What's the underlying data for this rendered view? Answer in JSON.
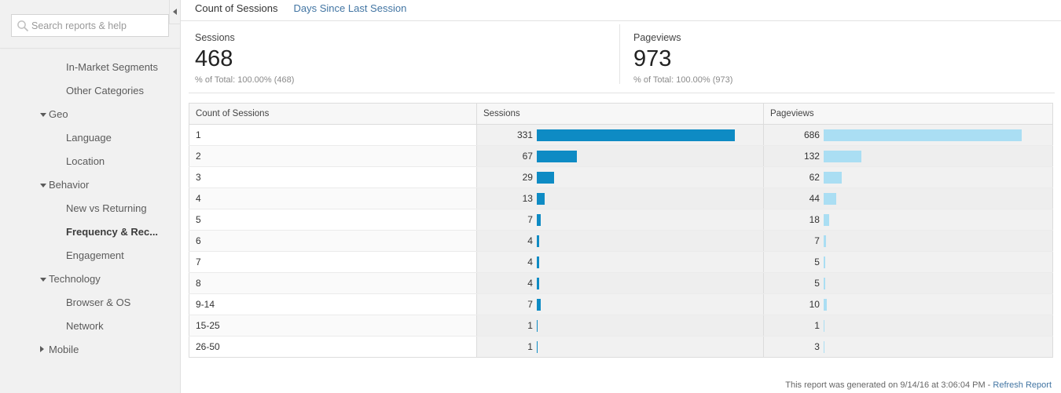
{
  "sidebar": {
    "search": {
      "placeholder": "Search reports & help",
      "value": "",
      "icon": "search-icon"
    },
    "items": [
      {
        "label": "In-Market Segments",
        "type": "leaf",
        "active": false,
        "caret": ""
      },
      {
        "label": "Other Categories",
        "type": "leaf",
        "active": false,
        "caret": ""
      },
      {
        "label": "Geo",
        "type": "group",
        "active": false,
        "caret": "open"
      },
      {
        "label": "Language",
        "type": "leaf",
        "active": false,
        "caret": ""
      },
      {
        "label": "Location",
        "type": "leaf",
        "active": false,
        "caret": ""
      },
      {
        "label": "Behavior",
        "type": "group",
        "active": false,
        "caret": "open"
      },
      {
        "label": "New vs Returning",
        "type": "leaf",
        "active": false,
        "caret": ""
      },
      {
        "label": "Frequency & Rec...",
        "type": "leaf",
        "active": true,
        "caret": ""
      },
      {
        "label": "Engagement",
        "type": "leaf",
        "active": false,
        "caret": ""
      },
      {
        "label": "Technology",
        "type": "group",
        "active": false,
        "caret": "open"
      },
      {
        "label": "Browser & OS",
        "type": "leaf",
        "active": false,
        "caret": ""
      },
      {
        "label": "Network",
        "type": "leaf",
        "active": false,
        "caret": ""
      },
      {
        "label": "Mobile",
        "type": "group",
        "active": false,
        "caret": "closed"
      }
    ],
    "collapse_toggle": {
      "icon": "chevron-left-icon"
    }
  },
  "tabs": [
    {
      "label": "Count of Sessions",
      "active": true
    },
    {
      "label": "Days Since Last Session",
      "active": false
    }
  ],
  "metrics": [
    {
      "label": "Sessions",
      "value": "468",
      "sub": "% of Total: 100.00% (468)"
    },
    {
      "label": "Pageviews",
      "value": "973",
      "sub": "% of Total: 100.00% (973)"
    }
  ],
  "colors": {
    "sessions_bar": "#0e8bc4",
    "pageviews_bar": "#aadef3",
    "link": "#4275a3",
    "sidebar_bg": "#f1f1f1"
  },
  "footer": {
    "text": "This report was generated on 9/14/16 at 3:06:04 PM - ",
    "link": "Refresh Report"
  },
  "chart_data": {
    "type": "table",
    "title": "Count of Sessions",
    "columns": [
      "Count of Sessions",
      "Sessions",
      "Pageviews"
    ],
    "categories": [
      "1",
      "2",
      "3",
      "4",
      "5",
      "6",
      "7",
      "8",
      "9-14",
      "15-25",
      "26-50"
    ],
    "series": [
      {
        "name": "Sessions",
        "values": [
          331,
          67,
          29,
          13,
          7,
          4,
          4,
          4,
          7,
          1,
          1
        ],
        "max": 331,
        "color": "#0e8bc4"
      },
      {
        "name": "Pageviews",
        "values": [
          686,
          132,
          62,
          44,
          18,
          7,
          5,
          5,
          10,
          1,
          3
        ],
        "max": 686,
        "color": "#aadef3"
      }
    ],
    "totals": {
      "Sessions": 468,
      "Pageviews": 973
    },
    "grid": false,
    "legend": "none"
  }
}
